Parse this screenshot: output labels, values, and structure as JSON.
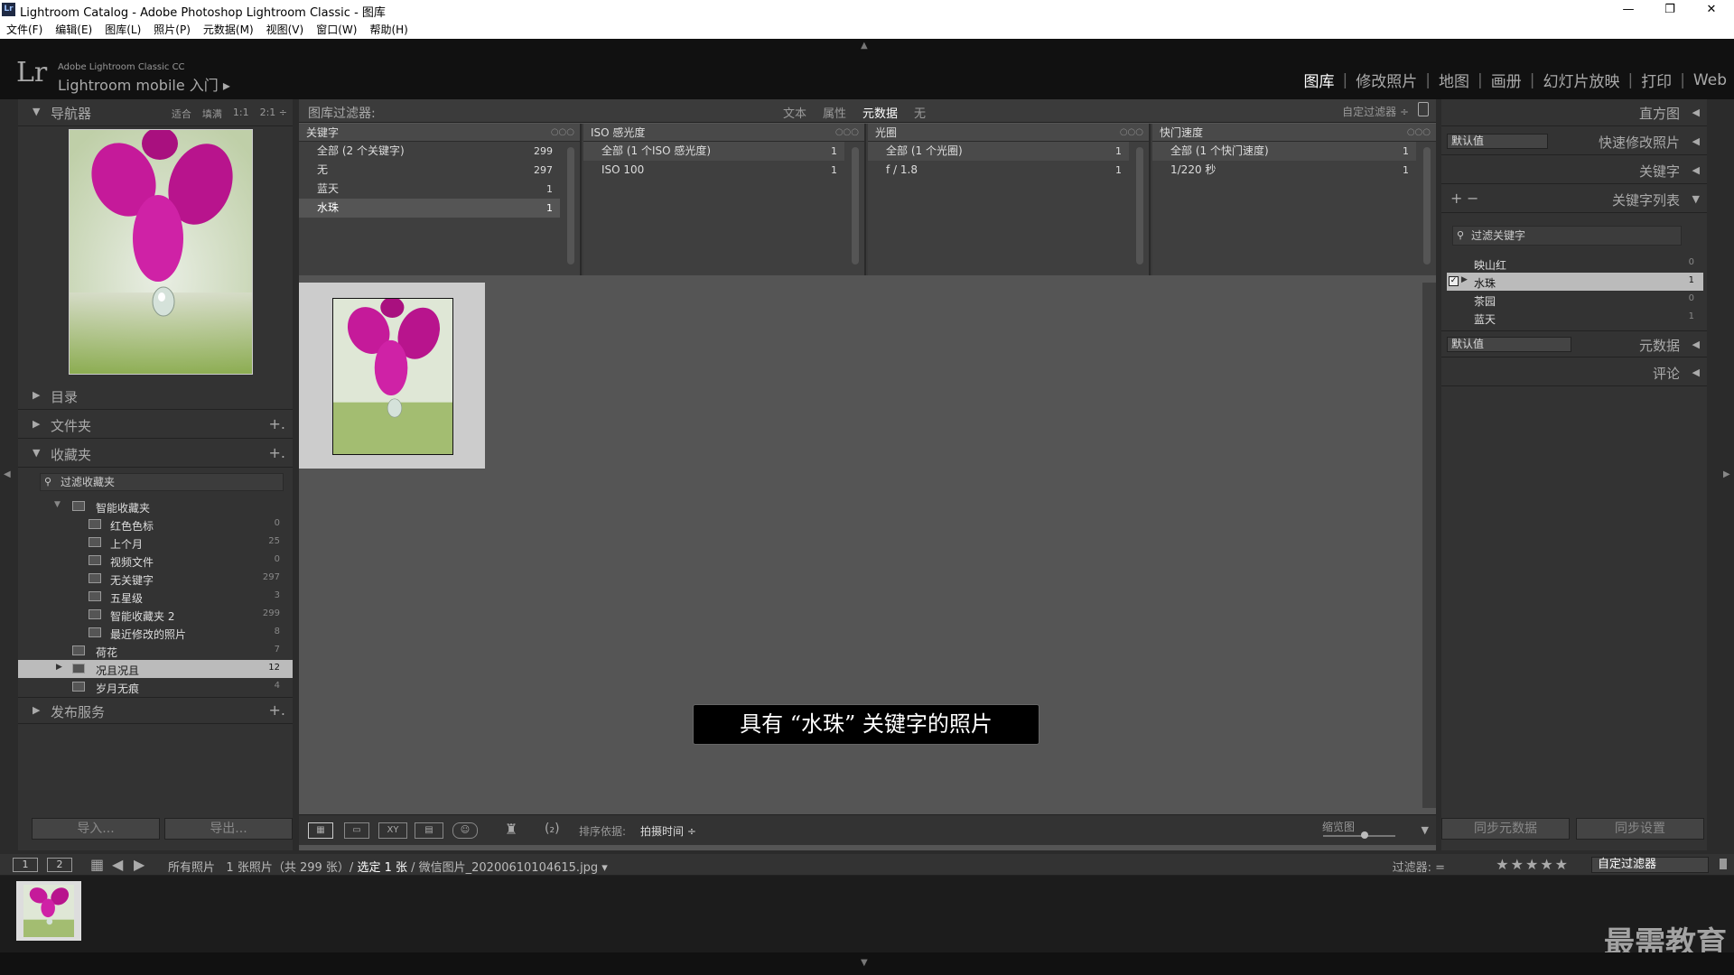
{
  "window": {
    "title": "Lightroom Catalog - Adobe Photoshop Lightroom Classic - 图库",
    "app_icon": "Lr",
    "minimize": "—",
    "maximize": "❐",
    "close": "✕"
  },
  "menu": [
    "文件(F)",
    "编辑(E)",
    "图库(L)",
    "照片(P)",
    "元数据(M)",
    "视图(V)",
    "窗口(W)",
    "帮助(H)"
  ],
  "header": {
    "logo": "Lr",
    "brand_small": "Adobe Lightroom Classic CC",
    "brand_main": "Lightroom mobile 入门 ▸",
    "modules": [
      "图库",
      "修改照片",
      "地图",
      "画册",
      "幻灯片放映",
      "打印",
      "Web"
    ],
    "active_module": "图库"
  },
  "left_panel": {
    "navigator": {
      "label": "导航器",
      "options": [
        "适合",
        "填满",
        "1:1",
        "2:1 ÷"
      ]
    },
    "catalog": {
      "label": "目录"
    },
    "folders": {
      "label": "文件夹",
      "plus": "+."
    },
    "collections": {
      "label": "收藏夹",
      "plus": "+.",
      "filter_placeholder": "过滤收藏夹",
      "items": [
        {
          "name": "智能收藏夹",
          "count": "",
          "level": 1,
          "expanded": true
        },
        {
          "name": "红色色标",
          "count": "0",
          "level": 2
        },
        {
          "name": "上个月",
          "count": "25",
          "level": 2
        },
        {
          "name": "视频文件",
          "count": "0",
          "level": 2
        },
        {
          "name": "无关键字",
          "count": "297",
          "level": 2
        },
        {
          "name": "五星级",
          "count": "3",
          "level": 2
        },
        {
          "name": "智能收藏夹 2",
          "count": "299",
          "level": 2
        },
        {
          "name": "最近修改的照片",
          "count": "8",
          "level": 2
        },
        {
          "name": "荷花",
          "count": "7",
          "level": 1
        },
        {
          "name": "况且况且",
          "count": "12",
          "level": 1,
          "selected": true
        },
        {
          "name": "岁月无痕",
          "count": "4",
          "level": 1
        }
      ]
    },
    "publish": {
      "label": "发布服务",
      "plus": "+."
    },
    "import_button": "导入...",
    "export_button": "导出..."
  },
  "filter_bar": {
    "title": "图库过滤器:",
    "tabs": [
      "文本",
      "属性",
      "元数据",
      "无"
    ],
    "active_tab": "元数据",
    "custom": "自定过滤器 ÷"
  },
  "metadata_columns": [
    {
      "header": "关键字",
      "rows": [
        {
          "label": "全部 (2 个关键字)",
          "count": "299"
        },
        {
          "label": "无",
          "count": "297"
        },
        {
          "label": "蓝天",
          "count": "1"
        },
        {
          "label": "水珠",
          "count": "1",
          "selected": true
        }
      ]
    },
    {
      "header": "ISO 感光度",
      "rows": [
        {
          "label": "全部 (1 个ISO 感光度)",
          "count": "1",
          "selected": true
        },
        {
          "label": "ISO 100",
          "count": "1"
        }
      ]
    },
    {
      "header": "光圈",
      "rows": [
        {
          "label": "全部 (1 个光圈)",
          "count": "1",
          "selected": true
        },
        {
          "label": "f / 1.8",
          "count": "1"
        }
      ]
    },
    {
      "header": "快门速度",
      "rows": [
        {
          "label": "全部 (1 个快门速度)",
          "count": "1",
          "selected": true
        },
        {
          "label": "1/220 秒",
          "count": "1"
        }
      ]
    }
  ],
  "tooltip": "具有 “水珠” 关键字的照片",
  "toolbar": {
    "sort_label": "排序依据:",
    "sort_value": "拍摄时间 ÷",
    "zoom_label": "缩览图",
    "xy": "XY",
    "num": "(₂)"
  },
  "right_panel": {
    "histogram": "直方图",
    "quick_develop": "快速修改照片",
    "preset_default": "默认值",
    "keywording": "关键字",
    "keyword_list": "关键字列表",
    "plus": "+",
    "minus": "−",
    "keyword_filter": "过滤关键字",
    "keywords": [
      {
        "name": "映山红",
        "count": "0"
      },
      {
        "name": "水珠",
        "count": "1",
        "selected": true,
        "checked": true
      },
      {
        "name": "茶园",
        "count": "0"
      },
      {
        "name": "蓝天",
        "count": "1"
      }
    ],
    "metadata": "元数据",
    "metadata_preset": "默认值",
    "comments": "评论",
    "sync_metadata": "同步元数据",
    "sync_settings": "同步设置"
  },
  "filmstrip_bar": {
    "screen1": "1",
    "screen2": "2",
    "source_prefix": "所有照片",
    "count_text": "1 张照片（共 299 张）/",
    "selected": "选定 1 张",
    "filename": "/ 微信图片_20200610104615.jpg ▾",
    "filter_label": "过滤器:",
    "filter_eq": "=",
    "stars": "★★★★★",
    "filter_value": "自定过滤器"
  },
  "watermark": "最需教育",
  "colors": {
    "accent": "#ffffff",
    "panel": "#333333",
    "center": "#555555"
  }
}
